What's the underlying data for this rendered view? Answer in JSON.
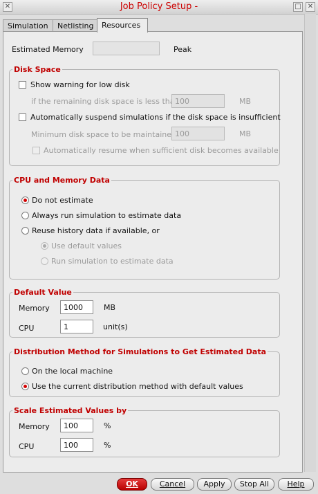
{
  "window": {
    "title": "Job Policy Setup -"
  },
  "tabs": [
    {
      "label": "Simulation"
    },
    {
      "label": "Netlisting"
    },
    {
      "label": "Resources"
    }
  ],
  "estimated_memory": {
    "label": "Estimated Memory",
    "value": "",
    "suffix": "Peak"
  },
  "disk_space": {
    "title": "Disk Space",
    "warn_low_disk": {
      "label": "Show warning for low disk",
      "checked": false
    },
    "remaining_label": "if the remaining disk space is less than",
    "remaining_value": "100",
    "remaining_unit": "MB",
    "auto_suspend": {
      "label": "Automatically suspend simulations if the disk space is insufficient",
      "checked": false
    },
    "min_label": "Minimum disk space to be maintained",
    "min_value": "100",
    "min_unit": "MB",
    "auto_resume": {
      "label": "Automatically resume when sufficient disk becomes available",
      "checked": false
    }
  },
  "cpu_memory": {
    "title": "CPU and Memory Data",
    "options": [
      {
        "label": "Do not estimate",
        "selected": true
      },
      {
        "label": "Always run simulation to estimate data",
        "selected": false
      },
      {
        "label": "Reuse history data if available, or",
        "selected": false
      }
    ],
    "sub_options": [
      {
        "label": "Use default values",
        "selected": true
      },
      {
        "label": "Run simulation to estimate data",
        "selected": false
      }
    ]
  },
  "default_value": {
    "title": "Default Value",
    "memory_label": "Memory",
    "memory_value": "1000",
    "memory_unit": "MB",
    "cpu_label": "CPU",
    "cpu_value": "1",
    "cpu_unit": "unit(s)"
  },
  "distribution": {
    "title": "Distribution Method for Simulations to Get Estimated Data",
    "options": [
      {
        "label": "On the local machine",
        "selected": false
      },
      {
        "label": "Use the current distribution method with default values",
        "selected": true
      }
    ]
  },
  "scale": {
    "title": "Scale Estimated Values by",
    "memory_label": "Memory",
    "memory_value": "100",
    "memory_unit": "%",
    "cpu_label": "CPU",
    "cpu_value": "100",
    "cpu_unit": "%"
  },
  "buttons": {
    "ok": "OK",
    "cancel": "Cancel",
    "apply": "Apply",
    "stop_all": "Stop All",
    "help": "Help"
  },
  "colors": {
    "accent": "#cc0000",
    "section_title": "#c00000"
  }
}
